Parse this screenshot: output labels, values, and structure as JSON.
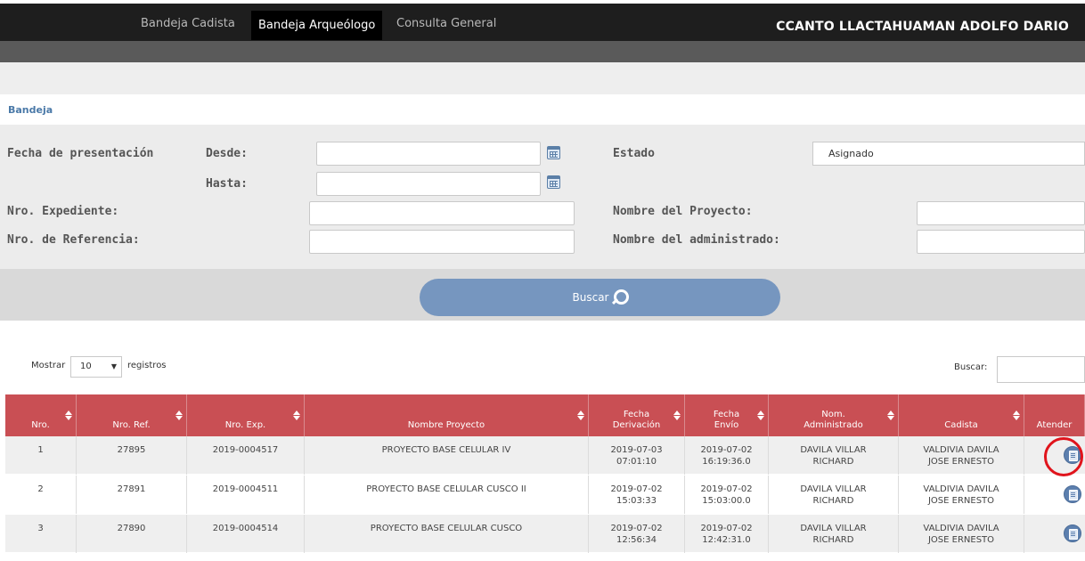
{
  "nav": {
    "items": [
      "Bandeja Cadista",
      "Bandeja Arqueólogo",
      "Consulta General"
    ],
    "active_index": 1,
    "user": "CCANTO LLACTAHUAMAN ADOLFO DARIO"
  },
  "breadcrumb": "Bandeja",
  "filters": {
    "fecha_label": "Fecha de presentación",
    "desde_label": "Desde:",
    "hasta_label": "Hasta:",
    "desde_value": "",
    "hasta_value": "",
    "estado_label": "Estado",
    "estado_value": "Asignado",
    "expediente_label": "Nro. Expediente:",
    "referencia_label": "Nro. de Referencia:",
    "proyecto_label": "Nombre del Proyecto:",
    "administrado_label": "Nombre del administrado:"
  },
  "search_button": "Buscar",
  "table_controls": {
    "mostrar": "Mostrar",
    "page_length": "10",
    "registros": "registros",
    "buscar": "Buscar:"
  },
  "table": {
    "headers": [
      "Nro.",
      "Nro. Ref.",
      "Nro. Exp.",
      "Nombre Proyecto",
      "Fecha\nDerivación",
      "Fecha\nEnvío",
      "Nom.\nAdministrado",
      "Cadista",
      "Atender"
    ],
    "rows": [
      [
        "1",
        "27895",
        "2019-0004517",
        "PROYECTO BASE CELULAR IV",
        "2019-07-03\n07:01:10",
        "2019-07-02\n16:19:36.0",
        "DAVILA VILLAR\nRICHARD",
        "VALDIVIA DAVILA\nJOSE ERNESTO"
      ],
      [
        "2",
        "27891",
        "2019-0004511",
        "PROYECTO BASE CELULAR CUSCO II",
        "2019-07-02\n15:03:33",
        "2019-07-02\n15:03:00.0",
        "DAVILA VILLAR\nRICHARD",
        "VALDIVIA DAVILA\nJOSE ERNESTO"
      ],
      [
        "3",
        "27890",
        "2019-0004514",
        "PROYECTO BASE CELULAR CUSCO",
        "2019-07-02\n12:56:34",
        "2019-07-02\n12:42:31.0",
        "DAVILA VILLAR\nRICHARD",
        "VALDIVIA DAVILA\nJOSE ERNESTO"
      ]
    ],
    "row_icon": "document-icon",
    "highlight_color": "#e0141c"
  },
  "colors": {
    "header_red": "#c94f54",
    "button_blue": "#7696bf",
    "navbar": "#1e1e1e"
  }
}
